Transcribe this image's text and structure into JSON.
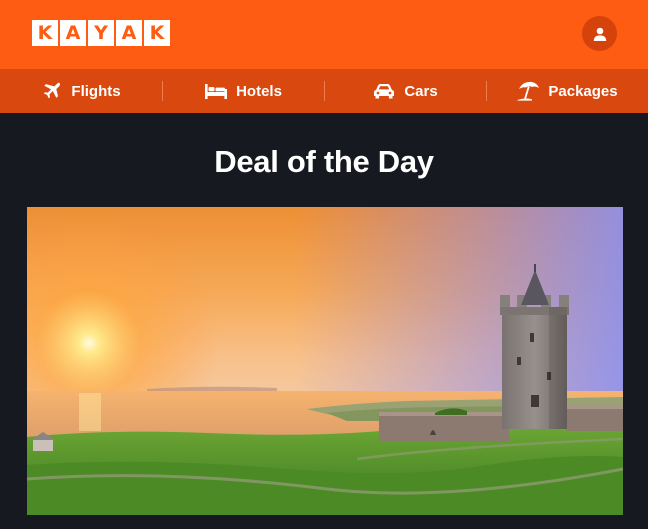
{
  "brand": {
    "logo_letters": [
      "K",
      "A",
      "Y",
      "A",
      "K"
    ],
    "color": "#ff5c13"
  },
  "header": {
    "account_icon": "user-icon"
  },
  "nav": {
    "items": [
      {
        "label": "Flights",
        "icon": "plane-icon"
      },
      {
        "label": "Hotels",
        "icon": "bed-icon"
      },
      {
        "label": "Cars",
        "icon": "car-icon"
      },
      {
        "label": "Packages",
        "icon": "beach-umbrella-icon"
      }
    ]
  },
  "main": {
    "title": "Deal of the Day",
    "hero": {
      "subject": "castle-tower-at-sunset-by-the-sea"
    }
  },
  "colors": {
    "nav_bg": "#d8480f",
    "page_bg": "#16191f",
    "text": "#ffffff"
  }
}
